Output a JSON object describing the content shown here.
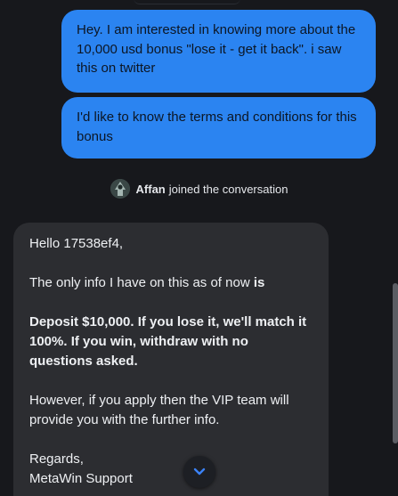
{
  "messages": {
    "user_1": "Hey. I am interested in knowing more about the 10,000 usd bonus \"lose it - get it back\". i saw this on twitter",
    "user_2": "I'd like to know the terms and conditions for this bonus"
  },
  "join_notice": {
    "name": "Affan",
    "text": "joined the conversation"
  },
  "agent_message": {
    "greeting": "Hello 17538ef4,",
    "line_info_prefix": "The only info I have on this as of now ",
    "line_info_bold": "is",
    "deposit_offer": "Deposit $10,000. If you lose it, we'll match it 100%. If you win, withdraw with no questions asked.",
    "vip_note": "However, if you apply then the VIP team will provide you with the further info.",
    "signoff": "Regards,",
    "signature": "MetaWin Support"
  },
  "icons": {
    "scroll_down": "chevron-down-icon",
    "avatar": "agent-avatar"
  },
  "colors": {
    "background": "#17181c",
    "user_bubble": "#2b84f1",
    "agent_bubble": "#2c2d31",
    "chevron": "#3b82f6"
  }
}
